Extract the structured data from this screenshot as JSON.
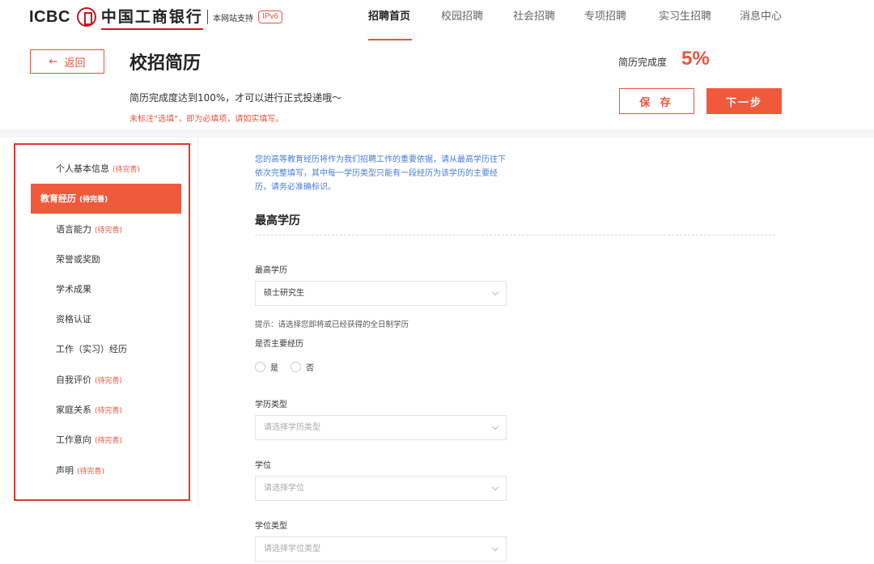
{
  "brand": {
    "logo_latin": "ICBC",
    "logo_cn": "中国工商银行",
    "site_support": "本网站支持",
    "ipv6": "IPv6"
  },
  "nav": {
    "items": [
      {
        "label": "招聘首页",
        "active": true
      },
      {
        "label": "校园招聘",
        "active": false
      },
      {
        "label": "社会招聘",
        "active": false
      },
      {
        "label": "专项招聘",
        "active": false
      },
      {
        "label": "实习生招聘",
        "active": false
      },
      {
        "label": "消息中心",
        "active": false
      }
    ]
  },
  "header": {
    "back_label": "返回",
    "back_arrow": "←",
    "title": "校招简历",
    "subtitle": "简历完成度达到100%，才可以进行正式投递哦～",
    "required_note": "未标注“选填”，即为必填项，请如实填写。",
    "completion_label": "简历完成度",
    "completion_value": "5%",
    "save_label": "保 存",
    "next_label": "下一步"
  },
  "sidebar": {
    "items": [
      {
        "label": "个人基本信息",
        "tag": "(待完善)"
      },
      {
        "label": "教育经历",
        "tag": "(待完善)",
        "active": true
      },
      {
        "label": "语言能力",
        "tag": "(待完善)"
      },
      {
        "label": "荣誉或奖励",
        "tag": ""
      },
      {
        "label": "学术成果",
        "tag": ""
      },
      {
        "label": "资格认证",
        "tag": ""
      },
      {
        "label": "工作（实习）经历",
        "tag": ""
      },
      {
        "label": "自我评价",
        "tag": "(待完善)"
      },
      {
        "label": "家庭关系",
        "tag": "(待完善)"
      },
      {
        "label": "工作意向",
        "tag": "(待完善)"
      },
      {
        "label": "声明",
        "tag": "(待完善)"
      }
    ]
  },
  "form": {
    "intro": "您的高等教育经历将作为我们招聘工作的重要依据，请从最高学历往下依次完整填写，其中每一学历类型只能有一段经历为该学历的主要经历，请务必准确标识。",
    "section_title": "最高学历",
    "highest_degree": {
      "label": "最高学历",
      "value": "硕士研究生"
    },
    "hint": "提示：请选择您即将或已经获得的全日制学历",
    "is_main": {
      "label": "是否主要经历",
      "yes": "是",
      "no": "否"
    },
    "edu_type": {
      "label": "学历类型",
      "placeholder": "请选择学历类型"
    },
    "degree": {
      "label": "学位",
      "placeholder": "请选择学位"
    },
    "degree_type": {
      "label": "学位类型",
      "placeholder": "请选择学位类型"
    }
  }
}
